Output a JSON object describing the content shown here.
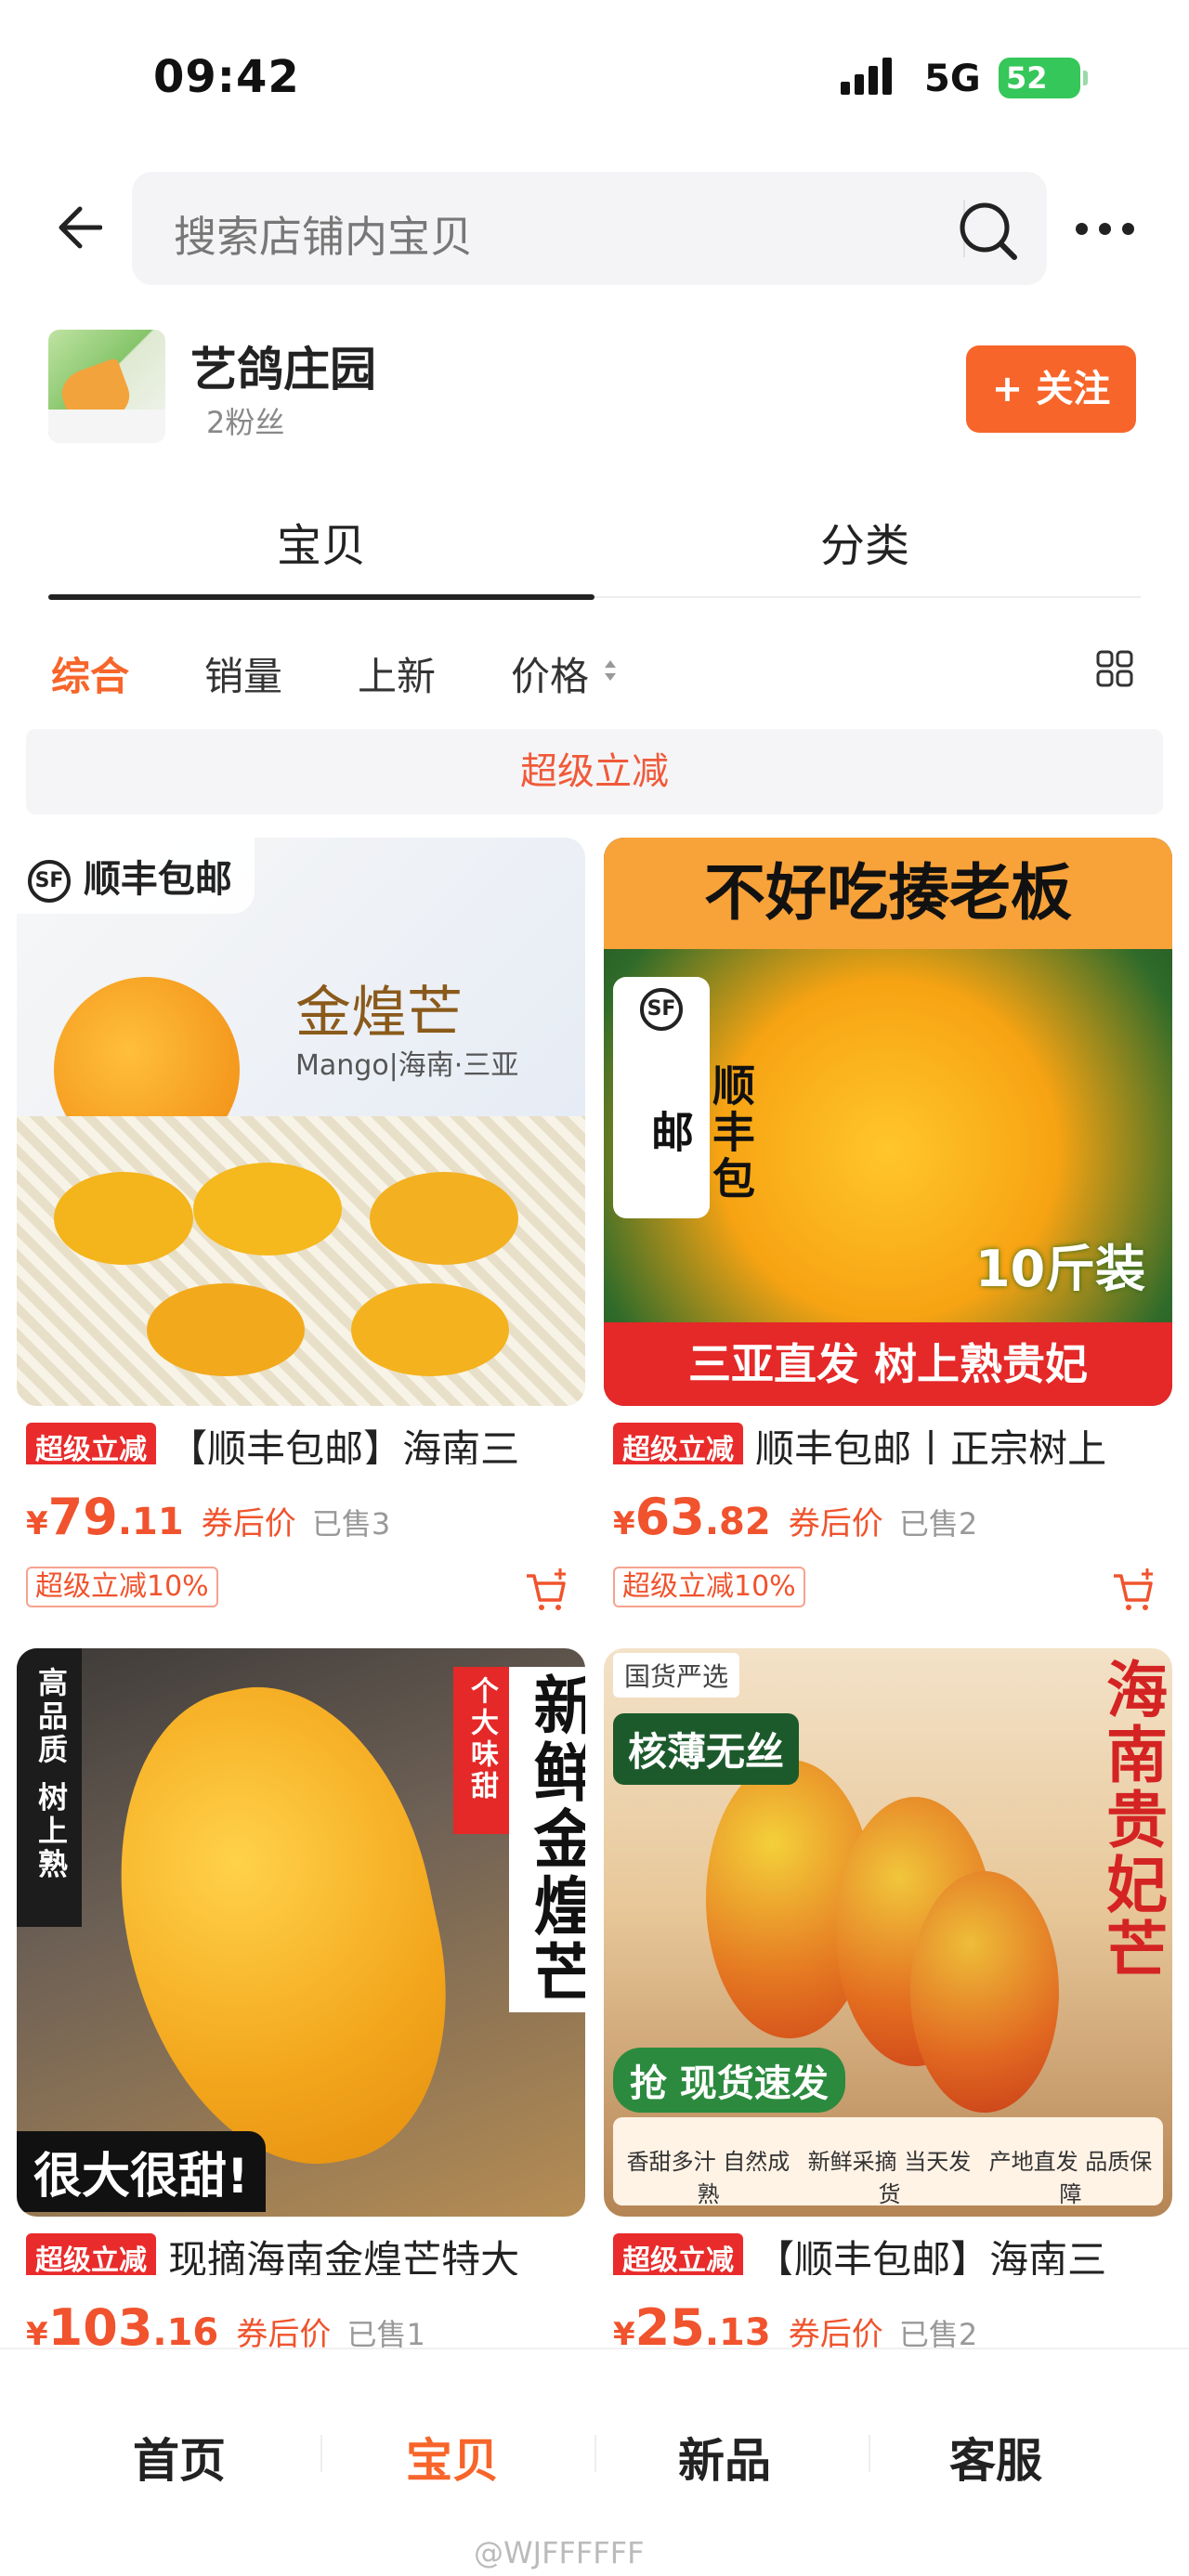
{
  "status_bar": {
    "time": "09:42",
    "network": "5G",
    "battery": "52"
  },
  "search": {
    "placeholder": "搜索店铺内宝贝"
  },
  "shop": {
    "name": "艺鸽庄园",
    "fans": "2粉丝",
    "follow_label": "+ 关注"
  },
  "tabs": [
    {
      "label": "宝贝",
      "active": true
    },
    {
      "label": "分类",
      "active": false
    }
  ],
  "sort": [
    {
      "label": "综合",
      "active": true
    },
    {
      "label": "销量"
    },
    {
      "label": "上新"
    },
    {
      "label": "价格"
    }
  ],
  "promo_band": "超级立减",
  "products": [
    {
      "tag": "超级立减",
      "title": "【顺丰包邮】海南三",
      "currency": "¥",
      "price_int": "79",
      "price_dec": ".11",
      "price_note": "券后价",
      "sold": "已售3",
      "discount": "超级立减10%",
      "image": {
        "badge": "顺丰包邮",
        "brand": "金煌芒",
        "subtitle": "Mango|海南·三亚",
        "sf": "SF"
      }
    },
    {
      "tag": "超级立减",
      "title": "顺丰包邮丨正宗树上",
      "currency": "¥",
      "price_int": "63",
      "price_dec": ".82",
      "price_note": "券后价",
      "sold": "已售2",
      "discount": "超级立减10%",
      "image": {
        "top_banner": "不好吃揍老板",
        "side": "顺丰包邮",
        "weight": "10斤装",
        "bottom_banner": "三亚直发 树上熟贵妃",
        "sf": "SF"
      }
    },
    {
      "tag": "超级立减",
      "title": "现摘海南金煌芒特大",
      "currency": "¥",
      "price_int": "103",
      "price_dec": ".16",
      "price_note": "券后价",
      "sold": "已售1",
      "image": {
        "left_strip": "高品质 树上熟",
        "small_strip": "个大味甜",
        "big_text": "新鲜金煌芒",
        "bottom": "很大很甜!"
      }
    },
    {
      "tag": "超级立减",
      "title": "【顺丰包邮】海南三",
      "currency": "¥",
      "price_int": "25",
      "price_dec": ".13",
      "price_note": "券后价",
      "sold": "已售2",
      "image": {
        "corner": "国货严选",
        "label": "核薄无丝",
        "vertical": "海南贵妃芒",
        "ribbon": "抢 现货速发",
        "features": [
          "香甜多汁 自然成熟",
          "新鲜采摘 当天发货",
          "产地直发 品质保障"
        ]
      }
    }
  ],
  "bottom_nav": [
    {
      "label": "首页"
    },
    {
      "label": "宝贝",
      "active": true
    },
    {
      "label": "新品"
    },
    {
      "label": "客服"
    }
  ],
  "watermark": "@WJFFFFFF",
  "colors": {
    "accent": "#f7652a",
    "price": "#f0532d",
    "tag": "#e92b2b"
  }
}
